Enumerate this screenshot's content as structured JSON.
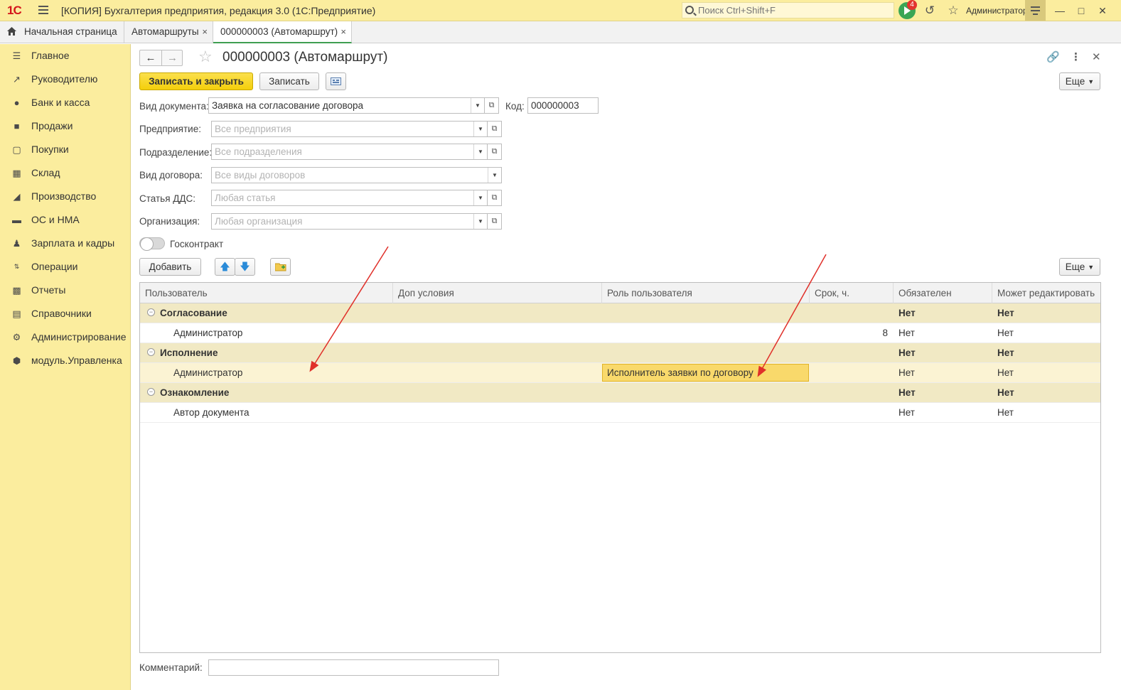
{
  "titlebar": {
    "logo": "1С",
    "title": "[КОПИЯ] Бухгалтерия предприятия, редакция 3.0  (1С:Предприятие)",
    "search_placeholder": "Поиск Ctrl+Shift+F",
    "notifications_count": "4",
    "user": "Администратор"
  },
  "tabs": {
    "home": "Начальная страница",
    "items": [
      {
        "label": "Автомаршруты",
        "close": "×"
      },
      {
        "label": "000000003 (Автомаршрут)",
        "close": "×"
      }
    ]
  },
  "sidebar": {
    "items": [
      {
        "label": "Главное",
        "icon": "menu-lines-icon"
      },
      {
        "label": "Руководителю",
        "icon": "trend-chart-icon"
      },
      {
        "label": "Банк и касса",
        "icon": "coin-icon"
      },
      {
        "label": "Продажи",
        "icon": "shopping-bag-icon"
      },
      {
        "label": "Покупки",
        "icon": "shopping-cart-icon"
      },
      {
        "label": "Склад",
        "icon": "warehouse-icon"
      },
      {
        "label": "Производство",
        "icon": "factory-icon"
      },
      {
        "label": "ОС и НМА",
        "icon": "truck-icon"
      },
      {
        "label": "Зарплата и кадры",
        "icon": "person-icon"
      },
      {
        "label": "Операции",
        "icon": "operations-icon"
      },
      {
        "label": "Отчеты",
        "icon": "bar-chart-icon"
      },
      {
        "label": "Справочники",
        "icon": "books-icon"
      },
      {
        "label": "Администрирование",
        "icon": "gear-icon"
      },
      {
        "label": "модуль.Управленка",
        "icon": "module-icon"
      }
    ]
  },
  "form": {
    "title": "000000003 (Автомаршрут)",
    "buttons": {
      "save_close": "Записать и закрыть",
      "save": "Записать",
      "more": "Еще",
      "add": "Добавить"
    },
    "fields": {
      "doc_type": {
        "label": "Вид документа:",
        "value": "Заявка на согласование договора"
      },
      "code": {
        "label": "Код:",
        "value": "000000003"
      },
      "enterprise": {
        "label": "Предприятие:",
        "placeholder": "Все предприятия"
      },
      "department": {
        "label": "Подразделение:",
        "placeholder": "Все подразделения"
      },
      "contract_type": {
        "label": "Вид договора:",
        "placeholder": "Все виды договоров"
      },
      "cash_item": {
        "label": "Статья ДДС:",
        "placeholder": "Любая статья"
      },
      "organization": {
        "label": "Организация:",
        "placeholder": "Любая организация"
      },
      "gov_contract": {
        "label": "Госконтракт",
        "checked": false
      },
      "comment": {
        "label": "Комментарий:",
        "value": ""
      }
    }
  },
  "table": {
    "columns": [
      "Пользователь",
      "Доп условия",
      "Роль пользователя",
      "Срок, ч.",
      "Обязателен",
      "Может редактировать"
    ],
    "rows": [
      {
        "type": "group",
        "user": "Согласование",
        "cond": "",
        "role": "",
        "term": "",
        "required": "Нет",
        "editable": "Нет"
      },
      {
        "type": "item",
        "user": "Администратор",
        "cond": "",
        "role": "",
        "term": "8",
        "required": "Нет",
        "editable": "Нет"
      },
      {
        "type": "group",
        "user": "Исполнение",
        "cond": "",
        "role": "",
        "term": "",
        "required": "Нет",
        "editable": "Нет"
      },
      {
        "type": "item",
        "user": "Администратор",
        "cond": "",
        "role": "Исполнитель заявки по договору",
        "term": "",
        "required": "Нет",
        "editable": "Нет"
      },
      {
        "type": "group",
        "user": "Ознакомление",
        "cond": "",
        "role": "",
        "term": "",
        "required": "Нет",
        "editable": "Нет"
      },
      {
        "type": "item",
        "user": "Автор документа",
        "cond": "",
        "role": "",
        "term": "",
        "required": "Нет",
        "editable": "Нет"
      }
    ]
  },
  "colors": {
    "accent_yellow": "#fbed9e",
    "primary_button": "#f4cf0b",
    "group_row": "#f1e9c4",
    "highlight_cell": "#f9d96b",
    "annotation_arrow": "#e0302a",
    "active_tab": "#3f9e52"
  }
}
